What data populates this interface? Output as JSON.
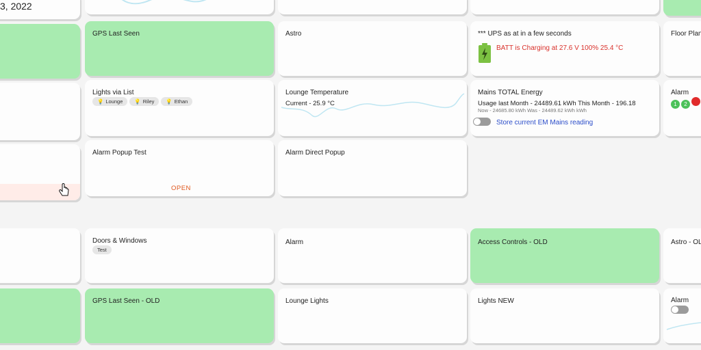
{
  "top_date": "3, 2022",
  "tiles": {
    "gps_last_seen": "GPS Last Seen",
    "astro": "Astro",
    "ups": {
      "title": "*** UPS as at in a few seconds",
      "status": "BATT is Charging at 27.6 V 100% 25.4 °C",
      "battery_color": "#7cc142",
      "status_color": "#d9312b"
    },
    "floor_plan": "Floor Plan",
    "lights_list": {
      "title": "Lights via List",
      "items": [
        "Lounge",
        "Riley",
        "Ethan"
      ]
    },
    "lounge_temp": {
      "title": "Lounge Temperature",
      "value": "Current - 25.9 °C"
    },
    "mains_energy": {
      "title": "Mains TOTAL Energy",
      "usage": "Usage last Month - 24489.61 kWh This Month - 196.18",
      "sub": "Now - 24685.80 kWh Was - 24489.62 kWh kWh",
      "action": "Store current EM Mains reading"
    },
    "alarm_right": {
      "title": "Alarm",
      "dots": [
        "1",
        "2",
        ""
      ]
    },
    "alarm_popup": {
      "title": "Alarm Popup Test",
      "action": "OPEN",
      "action_color": "#e0561b"
    },
    "alarm_direct": "Alarm Direct Popup",
    "doors_windows": {
      "title": "Doors & Windows",
      "chip": "Test"
    },
    "alarm_mid": "Alarm",
    "access_controls_old": "Access Controls - OLD",
    "astro_old": "Astro - OL",
    "gps_last_seen_old": "GPS Last Seen - OLD",
    "lounge_lights": "Lounge Lights",
    "lights_new": "Lights NEW",
    "alarm_bottom_right": "Alarm"
  }
}
